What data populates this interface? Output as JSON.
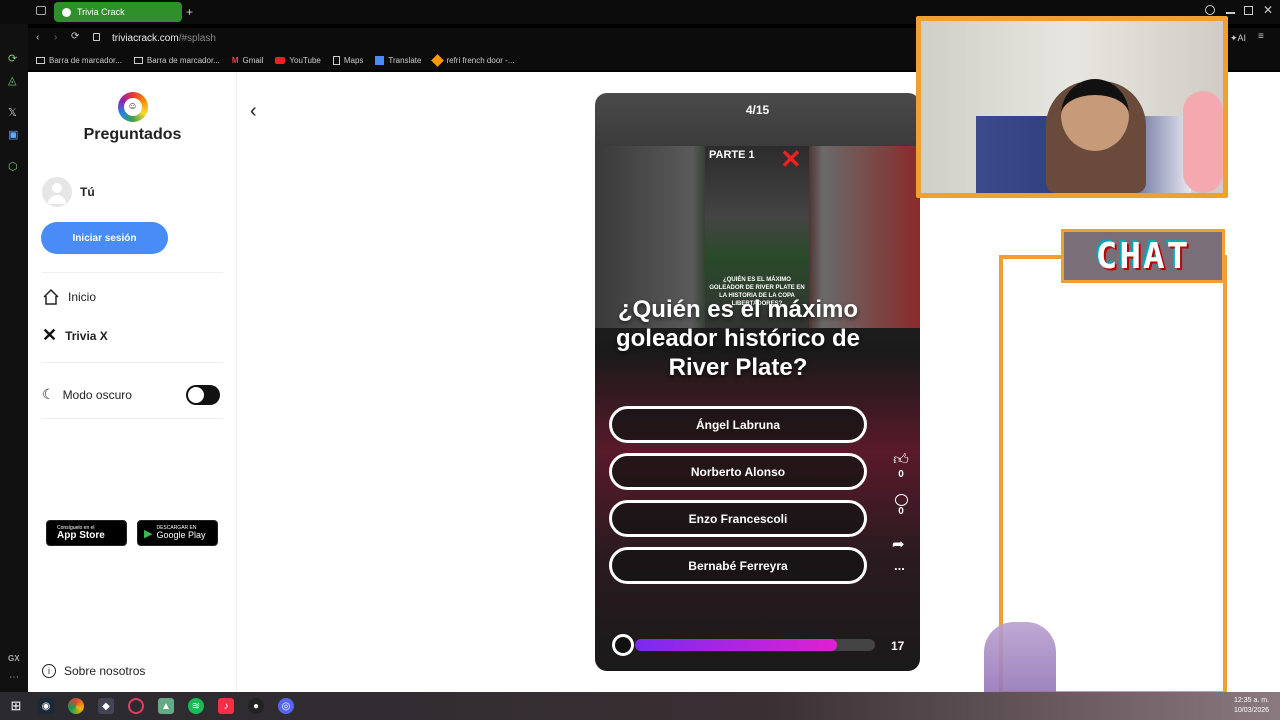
{
  "browser": {
    "tab_title": "Trivia Crack",
    "new_tab": "+",
    "url_domain": "triviacrack.com",
    "url_path": "/#splash",
    "ai_label": "AI",
    "bookmarks": [
      {
        "label": "Barra de marcador...",
        "icon": "folder-icon"
      },
      {
        "label": "Barra de marcador...",
        "icon": "folder-icon"
      },
      {
        "label": "Gmail",
        "icon": "gmail-icon"
      },
      {
        "label": "YouTube",
        "icon": "youtube-icon"
      },
      {
        "label": "Maps",
        "icon": "page-icon"
      },
      {
        "label": "Translate",
        "icon": "translate-icon"
      },
      {
        "label": "refri french door -...",
        "icon": "tag-icon"
      }
    ]
  },
  "sidebar": {
    "brand": "Preguntados",
    "user_name": "Tú",
    "login_button": "Iniciar sesión",
    "nav": [
      {
        "label": "Inicio",
        "icon": "home-icon"
      },
      {
        "label": "Trivia X",
        "icon": "x-logo-icon"
      }
    ],
    "dark_mode_label": "Modo oscuro",
    "app_store_small": "Consíguelo en el",
    "app_store_big": "App Store",
    "google_play_small": "DESCARGAR EN",
    "google_play_big": "Google Play",
    "about": "Sobre nosotros"
  },
  "quiz": {
    "progress": "4/15",
    "image_overlay_title": "PARTE 1",
    "image_caption": "¿QUIÉN ES EL MÁXIMO GOLEADOR DE RIVER PLATE EN LA HISTORIA DE LA COPA LIBERTADORES?",
    "question": "¿Quién es el máximo goleador histórico de River Plate?",
    "answers": [
      "Ángel Labruna",
      "Norberto Alonso",
      "Enzo Francescoli",
      "Bernabé Ferreyra"
    ],
    "likes": "0",
    "comments": "0",
    "more": "...",
    "timer_value": "17",
    "timer_fraction": 0.84
  },
  "overlay": {
    "chat_title": "CHAT"
  },
  "taskbar": {
    "time": "12:35 a. m.",
    "date": "10/03/2026"
  },
  "colors": {
    "accent_green": "#2f8f2b",
    "login_blue": "#4a8cf7",
    "overlay_orange": "#f0a030",
    "timer_purple": "#a020f0"
  }
}
